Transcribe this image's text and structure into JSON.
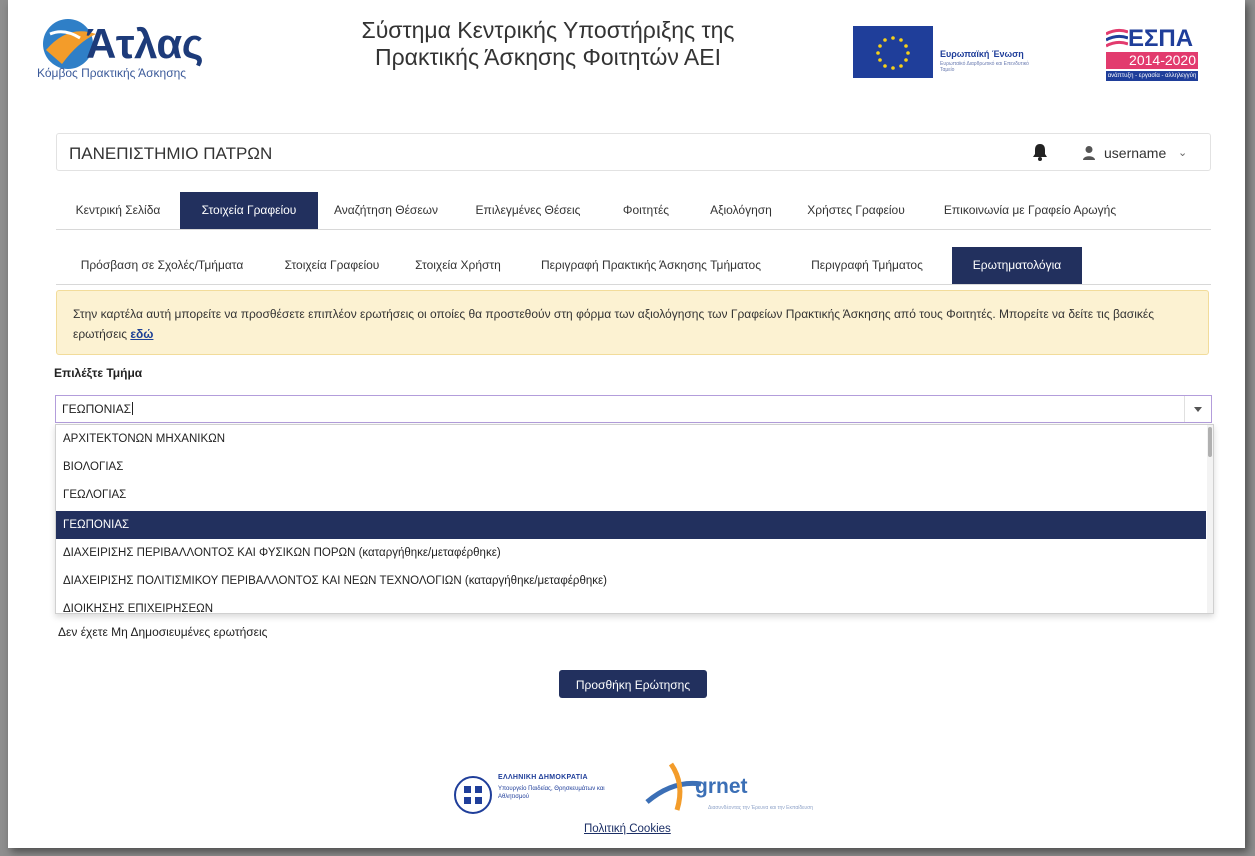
{
  "header": {
    "logo_name": "Άτλας",
    "logo_subtitle": "Κόμβος Πρακτικής Άσκησης",
    "system_title_line1": "Σύστημα Κεντρικής Υποστήριξης της",
    "system_title_line2": "Πρακτικής Άσκησης Φοιτητών ΑΕΙ",
    "eu_label": "Ευρωπαϊκή Ένωση",
    "eu_sublabel": "Ευρωπαϊκό Διαρθρωτικό και Επενδυτικό Ταμείο",
    "espa_name": "ΕΣΠΑ",
    "espa_years": "2014-2020",
    "espa_tagline": "ανάπτυξη - εργασία - αλληλεγγύη"
  },
  "institution_bar": {
    "name": "ΠΑΝΕΠΙΣΤΗΜΙΟ ΠΑΤΡΩΝ",
    "username": "username",
    "icons": [
      "bell-icon",
      "user-icon",
      "chevron-down-icon"
    ]
  },
  "main_nav": {
    "items": [
      {
        "label": "Κεντρική Σελίδα",
        "active": false
      },
      {
        "label": "Στοιχεία Γραφείου",
        "active": true
      },
      {
        "label": "Αναζήτηση Θέσεων",
        "active": false
      },
      {
        "label": "Επιλεγμένες Θέσεις",
        "active": false
      },
      {
        "label": "Φοιτητές",
        "active": false
      },
      {
        "label": "Αξιολόγηση",
        "active": false
      },
      {
        "label": "Χρήστες Γραφείου",
        "active": false
      },
      {
        "label": "Επικοινωνία με Γραφείο Αρωγής",
        "active": false
      }
    ]
  },
  "sub_nav": {
    "items": [
      {
        "label": "Πρόσβαση σε Σχολές/Τμήματα",
        "active": false
      },
      {
        "label": "Στοιχεία Γραφείου",
        "active": false
      },
      {
        "label": "Στοιχεία Χρήστη",
        "active": false
      },
      {
        "label": "Περιγραφή Πρακτικής Άσκησης Τμήματος",
        "active": false
      },
      {
        "label": "Περιγραφή Τμήματος",
        "active": false
      },
      {
        "label": "Ερωτηματολόγια",
        "active": true
      }
    ]
  },
  "alert": {
    "text": "Στην καρτέλα αυτή μπορείτε να προσθέσετε επιπλέον ερωτήσεις οι οποίες θα προστεθούν στη φόρμα των αξιολόγησης των Γραφείων Πρακτικής Άσκησης από τους Φοιτητές. Μπορείτε να δείτε τις βασικές ερωτήσεις ",
    "link_label": "εδώ"
  },
  "department_select": {
    "label": "Επιλέξτε Τμήμα",
    "value": "ΓΕΩΠΟΝΙΑΣ",
    "options": [
      "ΑΡΧΙΤΕΚΤΟΝΩΝ ΜΗΧΑΝΙΚΩΝ",
      "ΒΙΟΛΟΓΙΑΣ",
      "ΓΕΩΛΟΓΙΑΣ",
      "ΓΕΩΠΟΝΙΑΣ",
      "ΔΙΑΧΕΙΡΙΣΗΣ ΠΕΡΙΒΑΛΛΟΝΤΟΣ ΚΑΙ ΦΥΣΙΚΩΝ ΠΟΡΩΝ (καταργήθηκε/μεταφέρθηκε)",
      "ΔΙΑΧΕΙΡΙΣΗΣ ΠΟΛΙΤΙΣΜΙΚΟΥ ΠΕΡΙΒΑΛΛΟΝΤΟΣ ΚΑΙ ΝΕΩΝ ΤΕΧΝΟΛΟΓΙΩΝ (καταργήθηκε/μεταφέρθηκε)",
      "ΔΙΟΙΚΗΣΗΣ ΕΠΙΧΕΙΡΗΣΕΩΝ"
    ],
    "selected_index": 3
  },
  "content": {
    "no_questions_text": "Δεν έχετε Μη Δημοσιευμένες ερωτήσεις",
    "add_question_button": "Προσθήκη Ερώτησης"
  },
  "footer": {
    "hellenic_republic": "ΕΛΛΗΝΙΚΗ ΔΗΜΟΚΡΑΤΙΑ",
    "ministry": "Υπουργείο Παιδείας, Θρησκευμάτων και Αθλητισμού",
    "grnet_name": "grnet",
    "grnet_tagline": "Διασυνδέοντας την Έρευνα και την Εκπαίδευση",
    "cookies_link": "Πολιτική Cookies"
  },
  "colors": {
    "primary": "#22305e",
    "alert_bg": "#fcf2d2",
    "alert_border": "#f2dc9a",
    "link": "#1c3f95"
  }
}
